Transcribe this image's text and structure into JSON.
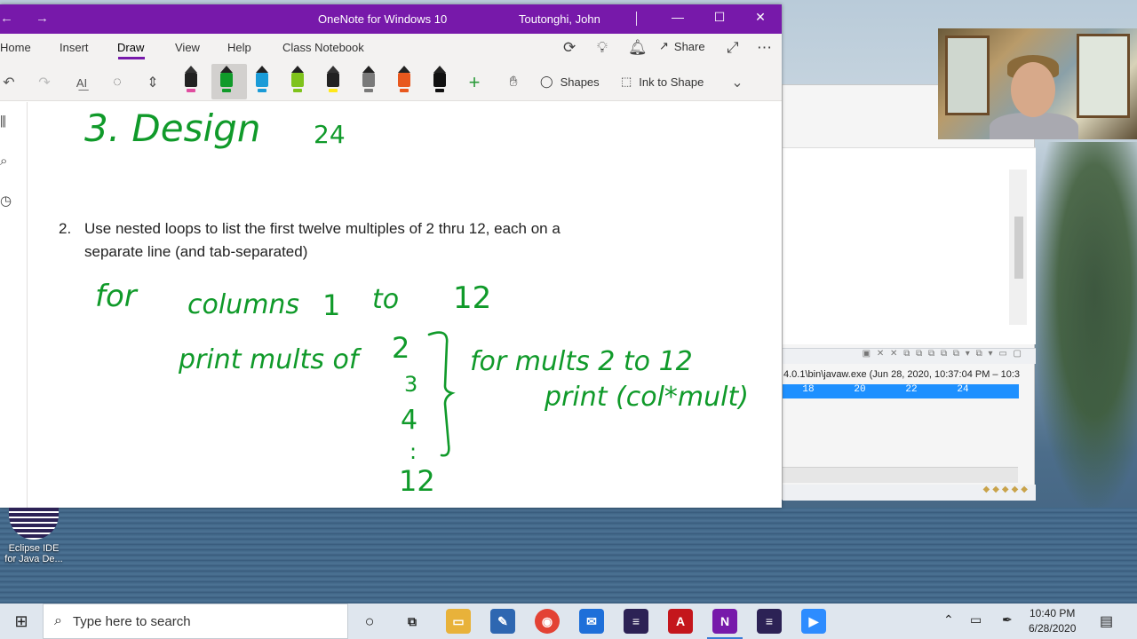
{
  "titlebar": {
    "title": "OneNote for Windows 10",
    "user": "Toutonghi, John"
  },
  "ribbon": {
    "tabs": [
      "Home",
      "Insert",
      "Draw",
      "View",
      "Help",
      "Class Notebook"
    ],
    "active_tab": "Draw",
    "share_label": "Share"
  },
  "draw_toolbar": {
    "shapes_label": "Shapes",
    "ink_to_shape_label": "Ink to Shape",
    "pens": [
      {
        "name": "highlighter-pink",
        "color": "#e04ea0"
      },
      {
        "name": "pen-green",
        "color": "#109a2a"
      },
      {
        "name": "pen-blue",
        "color": "#1a9bd7"
      },
      {
        "name": "pen-lime",
        "color": "#7fc31c"
      },
      {
        "name": "highlighter-yellow",
        "color": "#ffe81a"
      },
      {
        "name": "pen-galaxy",
        "color": "#7a7a7a"
      },
      {
        "name": "pen-rainbow",
        "color": "#e8581e"
      },
      {
        "name": "pen-black",
        "color": "#111111"
      }
    ]
  },
  "page": {
    "question_number": "2.",
    "question_text": "Use nested loops to list the first twelve multiples of 2 thru 12, each on a separate line (and tab-separated)",
    "ink_color": "#109a2a",
    "ink": {
      "heading": "3. Design",
      "top_number": "24",
      "line1_for": "for",
      "line1_columns": "columns",
      "line1_one": "1",
      "line1_to": "to",
      "line1_twelve": "12",
      "print_mults_of": "print mults of",
      "values": [
        "2",
        "3",
        "4",
        ":",
        "12"
      ],
      "for_mults": "for mults 2 to 12",
      "print_call": "print (col*mult)"
    }
  },
  "eclipse": {
    "console_path": "4.0.1\\bin\\javaw.exe  (Jun 28, 2020, 10:37:04 PM – 10:3",
    "console_values": [
      "18",
      "20",
      "22",
      "24"
    ]
  },
  "desktop_icon": {
    "label_line1": "Eclipse IDE",
    "label_line2": "for Java De..."
  },
  "taskbar": {
    "search_placeholder": "Type here to search",
    "time": "10:40 PM",
    "date": "6/28/2020"
  }
}
